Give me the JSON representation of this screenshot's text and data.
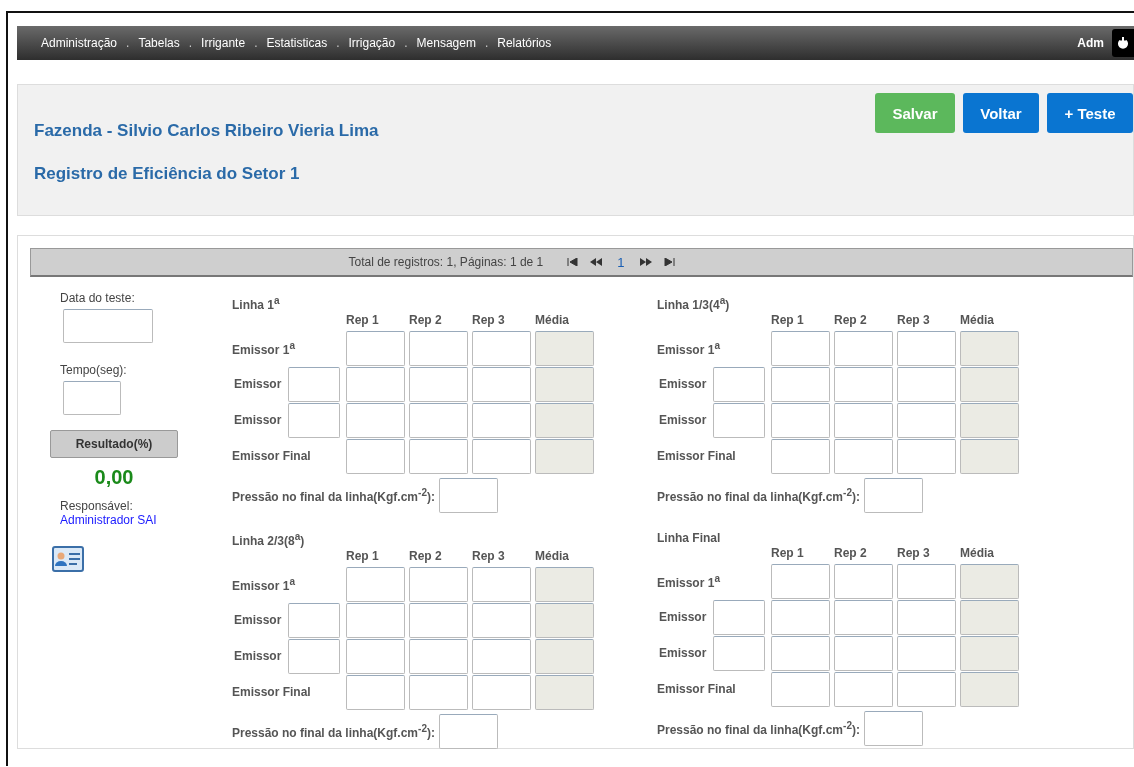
{
  "menu": {
    "items": [
      "Administração",
      "Tabelas",
      "Irrigante",
      "Estatisticas",
      "Irrigação",
      "Mensagem",
      "Relatórios"
    ],
    "separator": ".",
    "user": "Adm"
  },
  "header": {
    "farm": "Fazenda - Silvio Carlos Ribeiro Vieria Lima",
    "subtitle": "Registro de Eficiência do Setor 1",
    "buttons": [
      {
        "label": "Salvar",
        "kind": "success"
      },
      {
        "label": "Voltar",
        "kind": "primary"
      },
      {
        "label": "+ Teste",
        "kind": "primary"
      }
    ]
  },
  "pager": {
    "summary": "Total de registros: 1, Páginas: 1 de 1",
    "page": "1"
  },
  "test": {
    "date_label": "Data do teste:",
    "time_label": "Tempo(seg):",
    "result_label": "Resultado(%)",
    "result": "0,00",
    "responsible_label": "Responsável:",
    "responsible": "Administrador SAI"
  },
  "lines": [
    {
      "title": "Linha 1$^{a}$",
      "columns": [
        {
          "label": "Rep 1",
          "disabled": false
        },
        {
          "label": "Rep 2",
          "disabled": false
        },
        {
          "label": "Rep 3",
          "disabled": false
        },
        {
          "label": "Média",
          "disabled": true
        }
      ],
      "rows": [
        {
          "label": "Emissor 1$^{a}$",
          "kind": "fixed"
        },
        {
          "label": "Emissor",
          "kind": "numbered"
        },
        {
          "label": "Emissor",
          "kind": "numbered"
        },
        {
          "label": "Emissor Final",
          "kind": "fixed"
        }
      ],
      "pressure_label": "Pressão no final da linha(Kgf.cm$^{-2}$):"
    },
    {
      "title": "Linha 1/3(4$^{a}$)",
      "columns": [
        {
          "label": "Rep 1",
          "disabled": false
        },
        {
          "label": "Rep 2",
          "disabled": false
        },
        {
          "label": "Rep 3",
          "disabled": false
        },
        {
          "label": "Média",
          "disabled": true
        }
      ],
      "rows": [
        {
          "label": "Emissor 1$^{a}$",
          "kind": "fixed"
        },
        {
          "label": "Emissor",
          "kind": "numbered"
        },
        {
          "label": "Emissor",
          "kind": "numbered"
        },
        {
          "label": "Emissor Final",
          "kind": "fixed"
        }
      ],
      "pressure_label": "Pressão no final da linha(Kgf.cm$^{-2}$):"
    },
    {
      "title": "Linha 2/3(8$^{a}$)",
      "columns": [
        {
          "label": "Rep 1",
          "disabled": false
        },
        {
          "label": "Rep 2",
          "disabled": false
        },
        {
          "label": "Rep 3",
          "disabled": false
        },
        {
          "label": "Média",
          "disabled": true
        }
      ],
      "rows": [
        {
          "label": "Emissor 1$^{a}$",
          "kind": "fixed"
        },
        {
          "label": "Emissor",
          "kind": "numbered"
        },
        {
          "label": "Emissor",
          "kind": "numbered"
        },
        {
          "label": "Emissor Final",
          "kind": "fixed"
        }
      ],
      "pressure_label": "Pressão no final da linha(Kgf.cm$^{-2}$):"
    },
    {
      "title": "Linha Final",
      "columns": [
        {
          "label": "Rep 1",
          "disabled": false
        },
        {
          "label": "Rep 2",
          "disabled": false
        },
        {
          "label": "Rep 3",
          "disabled": false
        },
        {
          "label": "Média",
          "disabled": true
        }
      ],
      "rows": [
        {
          "label": "Emissor 1$^{a}$",
          "kind": "fixed"
        },
        {
          "label": "Emissor",
          "kind": "numbered"
        },
        {
          "label": "Emissor",
          "kind": "numbered"
        },
        {
          "label": "Emissor Final",
          "kind": "fixed"
        }
      ],
      "pressure_label": "Pressão no final da linha(Kgf.cm$^{-2}$):"
    }
  ]
}
